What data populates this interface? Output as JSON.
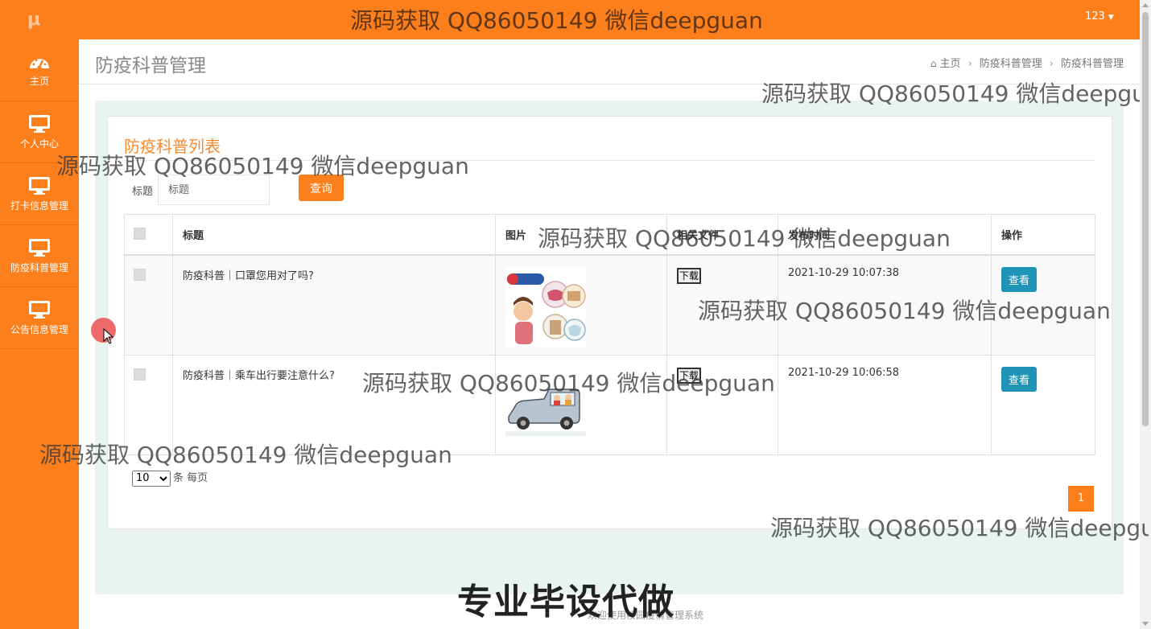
{
  "app": {
    "logo": "μ",
    "user_menu": "123"
  },
  "sidebar": {
    "items": [
      {
        "label": "主页",
        "icon": "dashboard-icon"
      },
      {
        "label": "个人中心",
        "icon": "monitor-icon"
      },
      {
        "label": "打卡信息管理",
        "icon": "monitor-icon"
      },
      {
        "label": "防疫科普管理",
        "icon": "monitor-icon"
      },
      {
        "label": "公告信息管理",
        "icon": "monitor-icon"
      }
    ]
  },
  "header": {
    "title": "防疫科普管理",
    "breadcrumb": [
      "主页",
      "防疫科普管理",
      "防疫科普管理"
    ]
  },
  "card": {
    "title": "防疫科普列表",
    "search": {
      "label": "标题",
      "placeholder": "标题",
      "button": "查询"
    }
  },
  "table": {
    "columns": [
      "",
      "标题",
      "图片",
      "相关文件",
      "发布时间",
      "操作"
    ],
    "rows": [
      {
        "title": "防疫科普｜口罩您用对了吗?",
        "image": "mask-infographic-thumbnail",
        "file_button": "下载",
        "time": "2021-10-29 10:07:38",
        "action": "查看"
      },
      {
        "title": "防疫科普｜乘车出行要注意什么?",
        "image": "car-cartoon-thumbnail",
        "file_button": "下载",
        "time": "2021-10-29 10:06:58",
        "action": "查看"
      }
    ]
  },
  "pagination": {
    "per_page_value": "10",
    "per_page_suffix": "条 每页",
    "current_page": "1"
  },
  "footer": {
    "text": "欢迎使用校园疫情管理系统"
  },
  "overlays": {
    "watermark": "源码获取 QQ86050149 微信deepguan",
    "ad_text": "专业毕设代做"
  },
  "colors": {
    "brand": "#fd7f1b",
    "view_button": "#1f94b7",
    "content_bg": "#e9f3ef"
  }
}
